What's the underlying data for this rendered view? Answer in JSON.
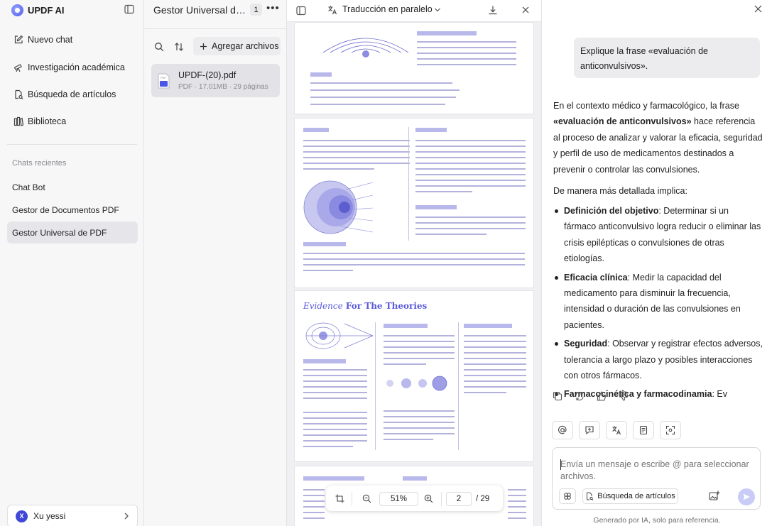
{
  "app": {
    "name": "UPDF AI"
  },
  "sidebar": {
    "nav": [
      {
        "label": "Nuevo chat",
        "icon": "edit-icon"
      },
      {
        "label": "Investigación académica",
        "icon": "telescope-icon"
      },
      {
        "label": "Búsqueda de artículos",
        "icon": "document-search-icon"
      },
      {
        "label": "Biblioteca",
        "icon": "library-icon"
      }
    ],
    "recent_label": "Chats recientes",
    "recent": [
      {
        "label": "Chat Bot"
      },
      {
        "label": "Gestor de Documentos PDF"
      },
      {
        "label": "Gestor Universal de PDF",
        "active": true
      }
    ],
    "user": {
      "initial": "X",
      "name": "Xu yessi"
    }
  },
  "files": {
    "title": "Gestor Universal de PDF",
    "count": "1",
    "add_label": "Agregar archivos",
    "items": [
      {
        "name": "UPDF-(20).pdf",
        "meta": "PDF · 17.01MB · 29 páginas"
      }
    ]
  },
  "viewer": {
    "mode_label": "Traducción en paralelo",
    "evidence_word": "Evidence",
    "evidence_rest": " For The Theories",
    "zoom": "51%",
    "page": "2",
    "total_pages": "/ 29"
  },
  "chat": {
    "user_message": "Explique la frase «evaluación de anticonvulsivos».",
    "answer_intro_1": "En el contexto médico y farmacológico, la frase ",
    "answer_intro_bold": "«evaluación de anticonvulsivos»",
    "answer_intro_2": " hace referencia al proceso de analizar y valorar la eficacia, seguridad y perfil de uso de medicamentos destinados a prevenir o controlar las convulsiones.",
    "answer_lead": "De manera más detallada implica:",
    "bullets": [
      {
        "term": "Definición del objetivo",
        "text": ": Determinar si un fármaco anticonvulsivo logra reducir o eliminar las crisis epilépticas o convulsiones de otras etiologías."
      },
      {
        "term": "Eficacia clínica",
        "text": ": Medir la capacidad del medicamento para disminuir la frecuencia, intensidad o duración de las convulsiones en pacientes."
      },
      {
        "term": "Seguridad",
        "text": ": Observar y registrar efectos adversos, tolerancia a largo plazo y posibles interacciones con otros fármacos."
      },
      {
        "term": "Farmacocinética y farmacodinamia",
        "text": ": Ev"
      }
    ],
    "input_placeholder": "Envía un mensaje o escribe @ para seleccionar archivos.",
    "article_search_label": "Búsqueda de artículos",
    "footnote": "Generado por IA, solo para referencia."
  },
  "colors": {
    "accent": "#4b55e8",
    "pdf_heading": "#5a5adc",
    "send": "#c8ccf6"
  }
}
